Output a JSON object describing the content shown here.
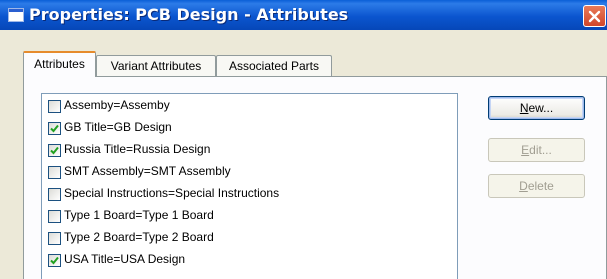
{
  "window": {
    "title": "Properties: PCB Design - Attributes"
  },
  "tabs": [
    {
      "label": "Attributes",
      "active": true
    },
    {
      "label": "Variant Attributes",
      "active": false
    },
    {
      "label": "Associated Parts",
      "active": false
    }
  ],
  "attributes": [
    {
      "label": "Assemby=Assemby",
      "checked": false
    },
    {
      "label": "GB Title=GB Design",
      "checked": true
    },
    {
      "label": "Russia Title=Russia Design",
      "checked": true
    },
    {
      "label": "SMT Assembly=SMT Assembly",
      "checked": false
    },
    {
      "label": "Special Instructions=Special Instructions",
      "checked": false
    },
    {
      "label": "Type 1 Board=Type 1 Board",
      "checked": false
    },
    {
      "label": "Type 2 Board=Type 2 Board",
      "checked": false
    },
    {
      "label": "USA Title=USA Design",
      "checked": true
    }
  ],
  "buttons": {
    "new": {
      "mnemonic": "N",
      "rest": "ew...",
      "enabled": true
    },
    "edit": {
      "mnemonic": "E",
      "rest": "dit...",
      "enabled": false
    },
    "delete": {
      "mnemonic": "D",
      "rest": "elete",
      "enabled": false
    }
  },
  "colors": {
    "titlebar": "#0A5FD6",
    "tab_highlight": "#E68B2C",
    "checkmark": "#21A121",
    "dialog_bg": "#ECE9D8"
  },
  "icons": {
    "title": "window-icon",
    "close": "close-icon",
    "check": "checkmark-icon"
  }
}
